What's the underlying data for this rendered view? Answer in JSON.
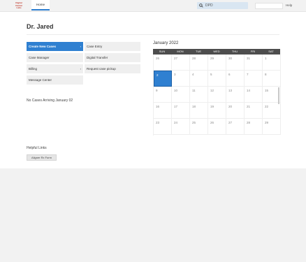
{
  "header": {
    "logo_lines": [
      "Digital",
      "Dental",
      "Labs"
    ],
    "home_tab": "Home",
    "search_value": "DPD",
    "help_label": "Help",
    "colors": {
      "accent": "#2f80d1",
      "logo": "#c0392b"
    }
  },
  "page": {
    "title": "Dr. Jared"
  },
  "menu": {
    "left": [
      {
        "label": "Create New Cases",
        "active": true,
        "caret": "›"
      },
      {
        "label": "Case Manager"
      },
      {
        "label": "Billing",
        "caret": "›"
      },
      {
        "label": "Message Center"
      }
    ],
    "right": [
      {
        "label": "Case Entry"
      },
      {
        "label": "Digital Transfer"
      },
      {
        "label": "Request case pickup"
      }
    ]
  },
  "no_cases_text": "No Cases Arriving January 02",
  "calendar": {
    "title": "January 2022",
    "days": [
      "SUN",
      "MON",
      "TUE",
      "WED",
      "THU",
      "FRI",
      "SAT"
    ],
    "weeks": [
      [
        "26",
        "27",
        "28",
        "29",
        "30",
        "31",
        "1"
      ],
      [
        "2",
        "3",
        "4",
        "5",
        "6",
        "7",
        "8"
      ],
      [
        "9",
        "10",
        "11",
        "12",
        "13",
        "14",
        "15"
      ],
      [
        "16",
        "17",
        "18",
        "19",
        "20",
        "21",
        "22"
      ],
      [
        "23",
        "24",
        "25",
        "26",
        "27",
        "28",
        "29"
      ]
    ],
    "selected": "2"
  },
  "helpful": {
    "title": "Helpful Links",
    "button": "Aligner Rx Form"
  }
}
